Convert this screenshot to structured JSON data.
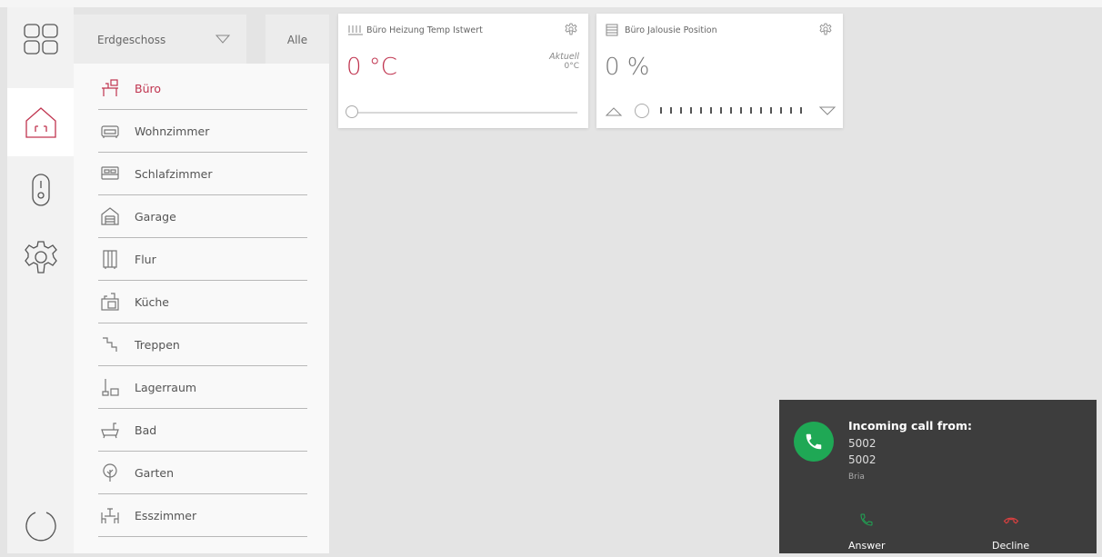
{
  "floor": {
    "selected": "Erdgeschoss",
    "all_label": "Alle"
  },
  "rooms": [
    {
      "label": "Büro",
      "icon": "desk-icon",
      "active": true
    },
    {
      "label": "Wohnzimmer",
      "icon": "sofa-icon"
    },
    {
      "label": "Schlafzimmer",
      "icon": "bed-icon"
    },
    {
      "label": "Garage",
      "icon": "garage-icon"
    },
    {
      "label": "Flur",
      "icon": "wardrobe-icon"
    },
    {
      "label": "Küche",
      "icon": "stove-icon"
    },
    {
      "label": "Treppen",
      "icon": "stairs-icon"
    },
    {
      "label": "Lagerraum",
      "icon": "broom-icon"
    },
    {
      "label": "Bad",
      "icon": "bathtub-icon"
    },
    {
      "label": "Garten",
      "icon": "tree-icon"
    },
    {
      "label": "Esszimmer",
      "icon": "dining-icon"
    }
  ],
  "widgets": {
    "heating": {
      "title": "Büro Heizung Temp Istwert",
      "value": "0 °C",
      "actual_label": "Aktuell",
      "actual_value": "0°C",
      "slider_fraction": 0
    },
    "blind": {
      "title": "Büro Jalousie Position",
      "value": "0 %",
      "position_fraction": 0
    }
  },
  "call": {
    "title": "Incoming call from:",
    "line1": "5002",
    "line2": "5002",
    "app": "Bria",
    "answer": "Answer",
    "decline": "Decline"
  },
  "colors": {
    "accent": "#c0344f",
    "answer_green": "#1fa855",
    "decline_red": "#e04040"
  }
}
